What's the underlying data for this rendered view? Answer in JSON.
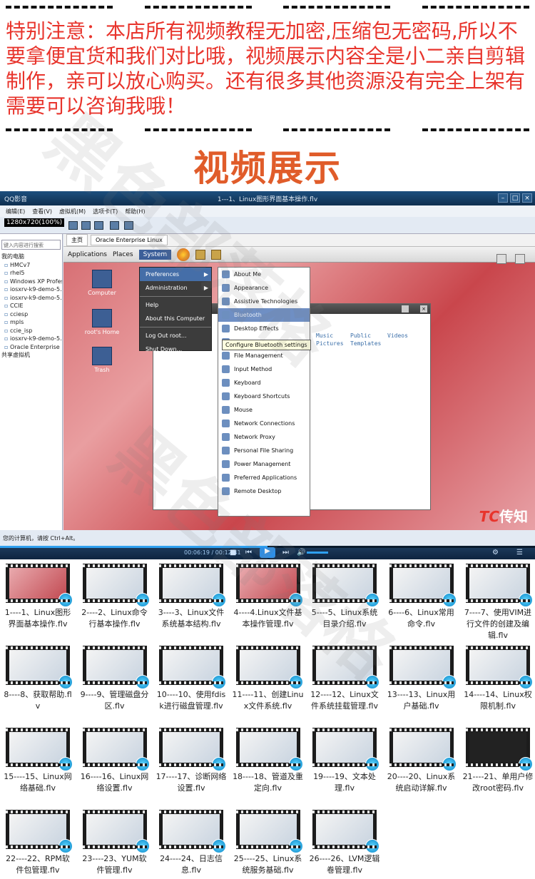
{
  "notice": {
    "text": "特别注意：本店所有视频教程无加密,压缩包无密码,所以不要拿便宜货和我们对比哦，视频展示内容全是小二亲自剪辑制作，亲可以放心购买。还有很多其他资源没有完全上架有需要可以咨询我哦！"
  },
  "section_title": "视频展示",
  "player": {
    "app_name": "QQ影音",
    "file_title": "1---1、Linux图形界面基本操作.flv",
    "time": "00:06:19 / 00:12:41",
    "progress": 0.5,
    "accent": "#2fa0ef"
  },
  "vm": {
    "menu": [
      "编辑(E)",
      "查看(V)",
      "虚拟机(M)",
      "选项卡(T)",
      "帮助(H)"
    ],
    "resolution": "1280x720(100%)",
    "search_placeholder": "键入内容进行搜索",
    "library_title": "我的电脑",
    "library_items": [
      "HMCv7",
      "rhel5",
      "Windows XP Profess",
      "iosxrv-k9-demo-5.1.",
      "iosxrv-k9-demo-5.1.",
      "CCIE",
      "cciesp",
      "mpls",
      "ccie_isp",
      "iosxrv-k9-demo-5.1.",
      "Oracle Enterprise Lir"
    ],
    "shared": "共享虚拟机",
    "status": "您的计算机，请按 Ctrl+Alt。",
    "tabs": [
      "主页",
      "Oracle Enterprise Linux"
    ]
  },
  "guest": {
    "panel": [
      "Applications",
      "Places",
      "System"
    ],
    "desktop_icons": [
      "Computer",
      "root's Home",
      "Trash"
    ],
    "system_menu": [
      {
        "label": "Preferences",
        "submenu": true,
        "highlight": true
      },
      {
        "label": "Administration",
        "submenu": true
      },
      {
        "label": "Help"
      },
      {
        "label": "About this Computer"
      },
      {
        "label": "Log Out root..."
      },
      {
        "label": "Shut Down..."
      }
    ],
    "preferences_menu": [
      "About Me",
      "Appearance",
      "Assistive Technologies",
      "Bluetooth",
      "Desktop Effects",
      "Display",
      "File Management",
      "Input Method",
      "Keyboard",
      "Keyboard Shortcuts",
      "Mouse",
      "Network Connections",
      "Network Proxy",
      "Personal File Sharing",
      "Power Management",
      "Preferred Applications",
      "Remote Desktop"
    ],
    "tooltip": "Configure Bluetooth settings",
    "folders": [
      "Music",
      "Public",
      "Videos",
      "Pictures",
      "Templates"
    ]
  },
  "logo": {
    "mark": "TC",
    "text": "传知"
  },
  "videos": [
    "1----1、Linux图形界面基本操作.flv",
    "2----2、Linux命令行基本操作.flv",
    "3----3、Linux文件系统基本结构.flv",
    "4----4.Linux文件基本操作管理.flv",
    "5----5、Linux系统目录介绍.flv",
    "6----6、Linux常用命令.flv",
    "7----7、使用VIM进行文件的创建及编辑.flv",
    "8----8、获取帮助.flv",
    "9----9、管理磁盘分区.flv",
    "10----10、使用fdisk进行磁盘管理.flv",
    "11----11、创建Linux文件系统.flv",
    "12----12、Linux文件系统挂载管理.flv",
    "13----13、Linux用户基础.flv",
    "14----14、Linux权限机制.flv",
    "15----15、Linux网络基础.flv",
    "16----16、Linux网络设置.flv",
    "17----17、诊断网络设置.flv",
    "18----18、管道及重定向.flv",
    "19----19、文本处理.flv",
    "20----20、Linux系统启动详解.flv",
    "21----21、单用户修改root密码.flv",
    "22----22、RPM软件包管理.flv",
    "23----23、YUM软件管理.flv",
    "24----24、日志信息.flv",
    "25----25、Linux系统服务基础.flv",
    "26----26、LVM逻辑卷管理.flv"
  ]
}
